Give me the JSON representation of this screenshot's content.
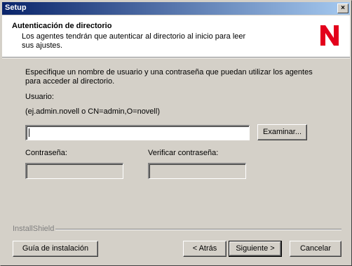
{
  "window": {
    "title": "Setup",
    "close_glyph": "×"
  },
  "header": {
    "title": "Autenticación de directorio",
    "subtitle": "Los agentes tendrán que autenticar al directorio al inicio para leer sus ajustes.",
    "logo_icon": "novell-n-logo",
    "logo_color": "#e3001b"
  },
  "form": {
    "instructions": "Especifique un nombre de usuario y una contraseña que puedan utilizar los agentes para acceder al directorio.",
    "user_label": "Usuario:",
    "user_example": "(ej.admin.novell o CN=admin,O=novell)",
    "user_value": "",
    "browse_label": "Examinar...",
    "password_label": "Contraseña:",
    "verify_label": "Verificar contraseña:"
  },
  "footer": {
    "brand": "InstallShield",
    "guide_label": "Guía de instalación",
    "back_label": "< Atrás",
    "next_label": "Siguiente >",
    "cancel_label": "Cancelar"
  }
}
